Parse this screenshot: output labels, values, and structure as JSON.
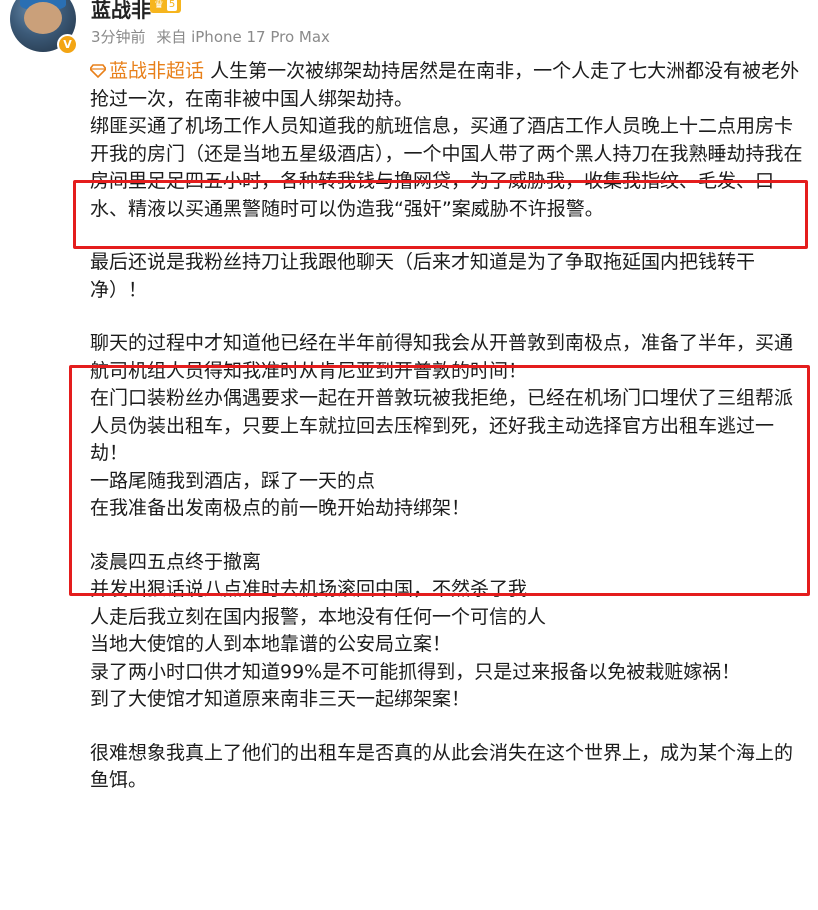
{
  "author": {
    "name": "蓝战非",
    "verified_mark": "V",
    "badge_level": "5"
  },
  "meta": {
    "time": "3分钟前",
    "source": "来自 iPhone 17 Pro Max"
  },
  "post": {
    "supertopic": "蓝战非超话",
    "lines": [
      "人生第一次被绑架劫持居然是在南非，一个人走了七大洲都没有被老外抢过一次，在南非被中国人绑架劫持。",
      "绑匪买通了机场工作人员知道我的航班信息，买通了酒店工作人员晚上十二点用房卡开我的房门（还是当地五星级酒店），一个中国人带了两个黑人持刀在我熟睡劫持我在房间里足足四五小时，各种转我钱与撸网贷，为了威胁我，收集我指纹、毛发、口水、精液以买通黑警随时可以伪造我“强奸”案威胁不许报警。",
      "最后还说是我粉丝持刀让我跟他聊天（后来才知道是为了争取拖延国内把钱转干净）！",
      "聊天的过程中才知道他已经在半年前得知我会从开普敦到南极点，准备了半年，买通航司机组人员得知我准时从肯尼亚到开普敦的时间！",
      "在门口装粉丝办偶遇要求一起在开普敦玩被我拒绝，已经在机场门口埋伏了三组帮派人员伪装出租车，只要上车就拉回去压榨到死，还好我主动选择官方出租车逃过一劫！",
      "一路尾随我到酒店，踩了一天的点",
      "在我准备出发南极点的前一晚开始劫持绑架！",
      "凌晨四五点终于撤离",
      "并发出狠话说八点准时去机场滚回中国，不然杀了我",
      "人走后我立刻在国内报警，本地没有任何一个可信的人",
      "当地大使馆的人到本地靠谱的公安局立案！",
      "录了两小时口供才知道99%是不可能抓得到，只是过来报备以免被栽赃嫁祸！",
      "到了大使馆才知道原来南非三天一起绑架案！",
      "很难想象我真上了他们的出租车是否真的从此会消失在这个世界上，成为某个海上的鱼饵。"
    ]
  },
  "colors": {
    "highlight_box": "#e41d1d",
    "supertopic": "#e8801a",
    "meta_gray": "#8a8a8a"
  }
}
